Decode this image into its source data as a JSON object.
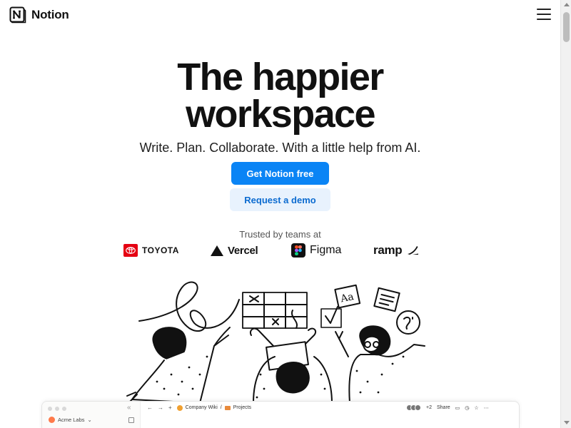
{
  "header": {
    "logo_text": "Notion",
    "logo_icon": "notion-logo",
    "menu_icon": "hamburger-menu-icon"
  },
  "hero": {
    "title_line1": "The happier",
    "title_line2": "workspace",
    "subtitle": "Write. Plan. Collaborate. With a little help from AI.",
    "primary_cta": "Get Notion free",
    "secondary_cta": "Request a demo"
  },
  "trusted": {
    "label": "Trusted by teams at",
    "brands": [
      "TOYOTA",
      "Vercel",
      "Figma",
      "ramp"
    ]
  },
  "preview": {
    "workspace_name": "Acme Labs",
    "breadcrumb_1": "Company Wiki",
    "breadcrumb_sep": "/",
    "breadcrumb_2": "Projects",
    "avatar_extra": "+2",
    "share_label": "Share"
  },
  "colors": {
    "primary": "#0a84f5",
    "secondary_bg": "#e8f2fd",
    "secondary_text": "#0b6bd0",
    "toyota": "#e50012"
  }
}
